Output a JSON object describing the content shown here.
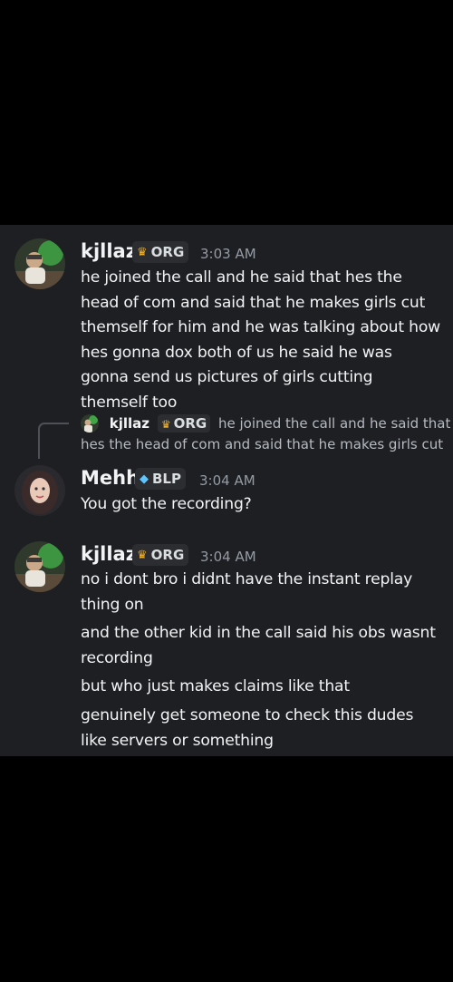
{
  "colors": {
    "chat_bg": "#1e1f22",
    "tag_bg": "#2b2d31",
    "timestamp": "#949ba4",
    "text": "#f2f3f5"
  },
  "messages": [
    {
      "username": "kjllaz",
      "tag_icon": "crown-badge-icon",
      "tag": "ORG",
      "time": "3:03 AM",
      "lines": [
        "he joined the call and he said that hes the head of com and said that he makes girls cut themself for him and he was talking about how hes gonna dox both of us he said he was gonna send us pictures of girls cutting themself too"
      ]
    },
    {
      "reply": {
        "username": "kjllaz",
        "tag": "ORG",
        "text_line1": "he joined the call and he said that",
        "text_line2": "hes the head of com and said that he makes girls cut"
      },
      "username": "Mehh",
      "tag_icon": "diamond-badge-icon",
      "tag": "BLP",
      "time": "3:04 AM",
      "lines": [
        "You got the recording?"
      ]
    },
    {
      "username": "kjllaz",
      "tag_icon": "crown-badge-icon",
      "tag": "ORG",
      "time": "3:04 AM",
      "lines": [
        "no i dont bro i didnt have the instant replay thing on",
        "and the other kid in the call said his obs wasnt recording",
        "but who just makes claims like that",
        "genuinely get someone to check this dudes like servers or something"
      ]
    }
  ]
}
